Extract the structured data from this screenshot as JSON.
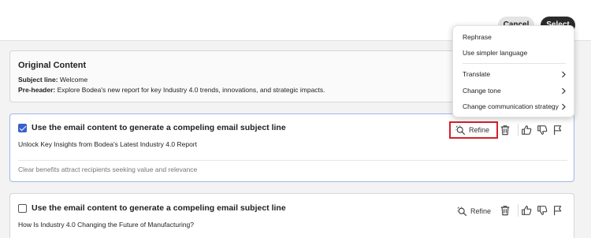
{
  "toolbar": {
    "cancel_label": "Cancel",
    "select_label": "Select"
  },
  "original": {
    "title": "Original Content",
    "subject_key": "Subject line:",
    "subject_value": "Welcome",
    "preheader_key": "Pre-header:",
    "preheader_value": "Explore Bodea's new report for key Industry 4.0 trends, innovations, and strategic impacts."
  },
  "suggestions": [
    {
      "checked": true,
      "prompt": "Use the email content to generate a compeling email subject line",
      "text": "Unlock Key Insights from Bodea's Latest Industry 4.0 Report",
      "reason": "Clear benefits attract recipients seeking value and relevance",
      "refine_label": "Refine"
    },
    {
      "checked": false,
      "prompt": "Use the email content to generate a compeling email subject line",
      "text": "How Is Industry 4.0 Changing the Future of Manufacturing?",
      "refine_label": "Refine"
    }
  ],
  "refine_menu": {
    "items": [
      "Rephrase",
      "Use simpler language"
    ],
    "submenus": [
      "Translate",
      "Change tone",
      "Change communication strategy"
    ]
  },
  "icons": [
    "refine-icon",
    "trash-icon",
    "thumbs-up-icon",
    "thumbs-down-icon",
    "flag-icon",
    "chevron-right-icon"
  ],
  "colors": {
    "selected_border": "#9fb8e8",
    "checkbox": "#3a5fcd",
    "highlight": "#d6202a"
  }
}
